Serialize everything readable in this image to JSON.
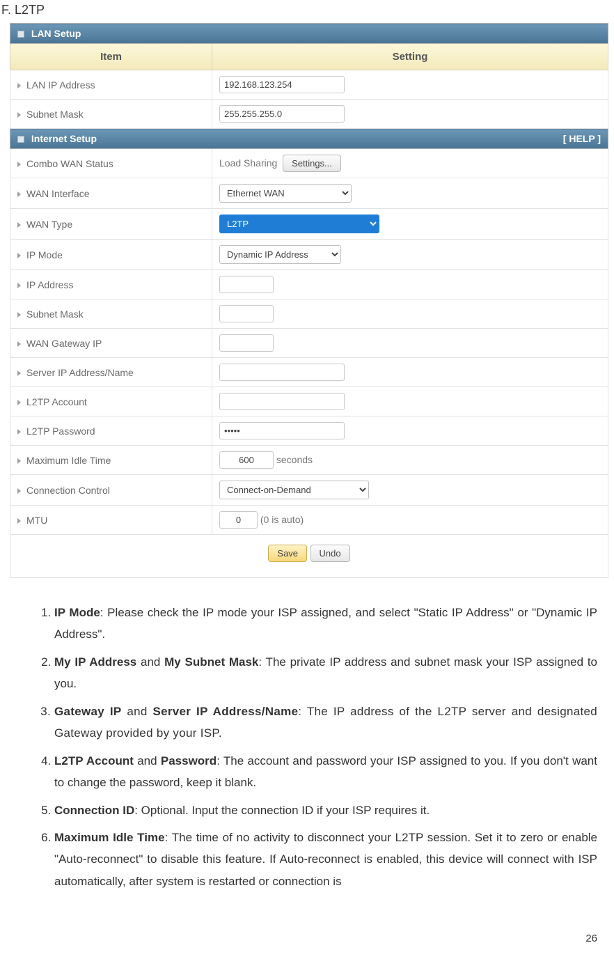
{
  "heading": "F. L2TP",
  "lan_setup": {
    "title": "LAN Setup",
    "header_item": "Item",
    "header_setting": "Setting",
    "rows": {
      "lan_ip_label": "LAN IP Address",
      "lan_ip_value": "192.168.123.254",
      "subnet_label": "Subnet Mask",
      "subnet_value": "255.255.255.0"
    }
  },
  "internet_setup": {
    "title": "Internet Setup",
    "help": "[ HELP ]",
    "combo_wan_label": "Combo WAN Status",
    "combo_wan_text": "Load Sharing",
    "settings_btn": "Settings...",
    "wan_interface_label": "WAN Interface",
    "wan_interface_value": "Ethernet WAN",
    "wan_type_label": "WAN Type",
    "wan_type_value": "L2TP",
    "ip_mode_label": "IP Mode",
    "ip_mode_value": "Dynamic IP Address",
    "ip_address_label": "IP Address",
    "ip_address_value": "",
    "subnet_mask_label": "Subnet Mask",
    "subnet_mask_value": "",
    "wan_gateway_label": "WAN Gateway IP",
    "wan_gateway_value": "",
    "server_ip_label": "Server IP Address/Name",
    "server_ip_value": "",
    "l2tp_account_label": "L2TP Account",
    "l2tp_account_value": "",
    "l2tp_password_label": "L2TP Password",
    "l2tp_password_value": "•••••",
    "max_idle_label": "Maximum Idle Time",
    "max_idle_value": "600",
    "max_idle_suffix": "seconds",
    "conn_ctrl_label": "Connection Control",
    "conn_ctrl_value": "Connect-on-Demand",
    "mtu_label": "MTU",
    "mtu_value": "0",
    "mtu_suffix": "(0 is auto)",
    "save_btn": "Save",
    "undo_btn": "Undo"
  },
  "notes": {
    "n1_b": "IP Mode",
    "n1_t": ": Please check the IP mode your ISP assigned, and select \"Static IP Address\" or \"Dynamic IP Address\".",
    "n2_b1": "My IP Address",
    "n2_m": " and ",
    "n2_b2": "My Subnet Mask",
    "n2_t": ": The private IP address and subnet mask your ISP assigned to you.",
    "n3_b1": "Gateway IP",
    "n3_m": " and ",
    "n3_b2": "Server IP Address/Name",
    "n3_t": ": The IP address of the L2TP server and designated Gateway provided by your ISP.",
    "n4_b1": "L2TP Account",
    "n4_m": " and ",
    "n4_b2": "Password",
    "n4_t": ": The account and password your ISP assigned to you. If you don't want to change the password, keep it blank.",
    "n5_b": "Connection ID",
    "n5_t": ": Optional. Input the connection ID if your ISP requires it.",
    "n6_b": "Maximum Idle Time",
    "n6_t": ": The time of no activity to disconnect your L2TP session. Set it to zero or enable \"Auto-reconnect\" to disable this feature. If Auto-reconnect is enabled, this device will connect with ISP automatically, after system is restarted or connection is"
  },
  "page_number": "26"
}
